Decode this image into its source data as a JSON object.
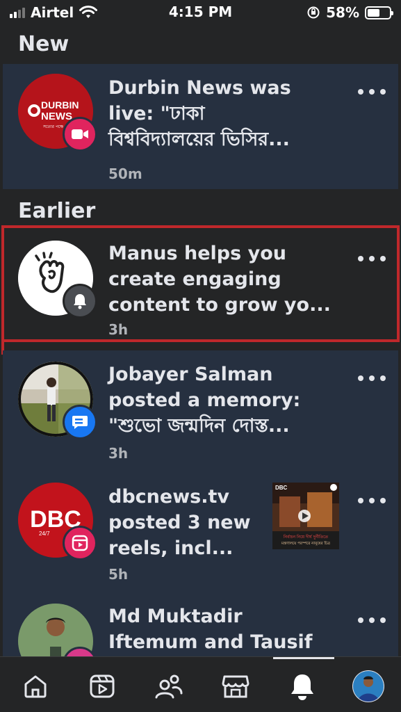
{
  "status": {
    "carrier": "Airtel",
    "time": "4:15 PM",
    "battery": "58%",
    "battery_level": 0.58
  },
  "sections": {
    "new": "New",
    "earlier": "Earlier"
  },
  "notifications": [
    {
      "line1": "Durbin News was",
      "line2": "live: \"ঢাকা",
      "line3": "বিশ্ববিদ্যালয়ের ভিসির...",
      "time": "50m",
      "avatar_text_top": "DURBIN",
      "avatar_text_bottom": "NEWS",
      "avatar_sub": "সত্যের পক্ষে",
      "badge_icon": "video-camera-icon",
      "badge_color": "#e0245e"
    },
    {
      "line1": "Manus helps you",
      "line2": "create engaging",
      "line3": "content to grow yo...",
      "time": "3h",
      "badge_icon": "bell-icon",
      "badge_color": "#4a4d52"
    },
    {
      "line1": "Jobayer Salman",
      "line2": "posted a memory:",
      "line3": "\"শুভো জন্মদিন দোস্ত...",
      "time": "3h",
      "badge_icon": "message-icon",
      "badge_color": "#1877f2"
    },
    {
      "line1": "dbcnews.tv",
      "line2": "posted 3 new",
      "line3": "reels, incl...",
      "time": "5h",
      "avatar_text": "DBC",
      "avatar_sub": "24/7",
      "thumb_logo": "DBC",
      "thumb_caption1": "নির্বাচন নিয়ে দীর্ঘ দুর্নীতিতে",
      "thumb_caption2": "মন্ত্রণালয়ে পরস্পরে নানুষের চিত্র",
      "badge_icon": "reels-icon",
      "badge_color": "#e0245e"
    },
    {
      "line1": "Md Muktadir",
      "line2": "Iftemum and Tausif",
      "badge_color": "#d8398a"
    }
  ],
  "tabs": [
    "home-tab",
    "video-tab",
    "friends-tab",
    "marketplace-tab",
    "notifications-tab",
    "profile-tab"
  ]
}
